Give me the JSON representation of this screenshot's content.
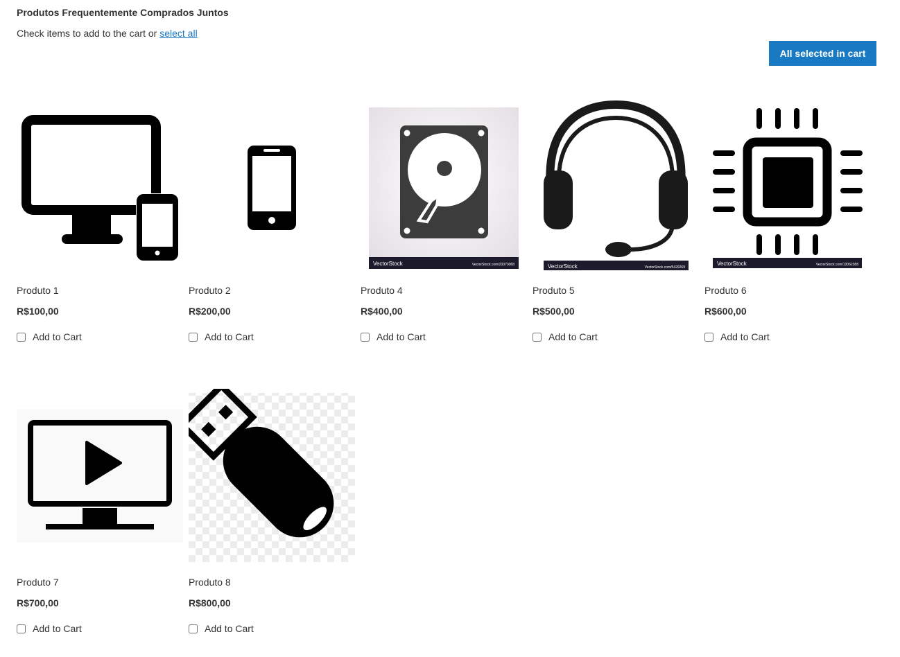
{
  "header": {
    "title": "Produtos Frequentemente Comprados Juntos",
    "subtitle_text": "Check items to add to the cart or ",
    "select_all_label": "select all",
    "all_selected_button": "All selected in cart"
  },
  "products": [
    {
      "name": "Produto 1",
      "price": "R$100,00",
      "add_label": "Add to Cart",
      "icon": "desktop-mobile-icon"
    },
    {
      "name": "Produto 2",
      "price": "R$200,00",
      "add_label": "Add to Cart",
      "icon": "smartphone-icon"
    },
    {
      "name": "Produto 4",
      "price": "R$400,00",
      "add_label": "Add to Cart",
      "icon": "hard-drive-icon"
    },
    {
      "name": "Produto 5",
      "price": "R$500,00",
      "add_label": "Add to Cart",
      "icon": "headset-icon"
    },
    {
      "name": "Produto 6",
      "price": "R$600,00",
      "add_label": "Add to Cart",
      "icon": "cpu-chip-icon"
    },
    {
      "name": "Produto 7",
      "price": "R$700,00",
      "add_label": "Add to Cart",
      "icon": "tv-play-icon"
    },
    {
      "name": "Produto 8",
      "price": "R$800,00",
      "add_label": "Add to Cart",
      "icon": "usb-drive-icon"
    }
  ],
  "watermarks": {
    "brand": "VectorStock",
    "hdd_url": "VectorStock.com/23373068",
    "headset_url": "VectorStock.com/5429269",
    "chip_url": "VectorStock.com/13062388"
  },
  "colors": {
    "accent": "#1979c3",
    "text": "#333333"
  }
}
